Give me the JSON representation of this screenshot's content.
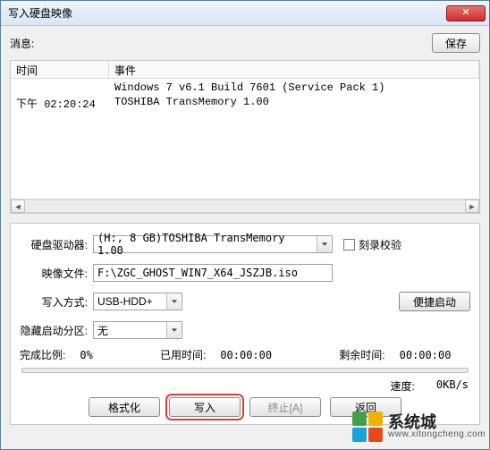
{
  "window": {
    "title": "写入硬盘映像",
    "close_glyph": "✕"
  },
  "top": {
    "message_label": "消息:",
    "save_label": "保存"
  },
  "log": {
    "col_time": "时间",
    "col_event": "事件",
    "rows": [
      {
        "time": "",
        "event": "Windows 7 v6.1 Build 7601 (Service Pack 1)"
      },
      {
        "time": "下午 02:20:24",
        "event": "TOSHIBA TransMemory    1.00"
      }
    ],
    "scroll_left": "◄",
    "scroll_right": "►"
  },
  "form": {
    "drive_label": "硬盘驱动器:",
    "drive_value": "(H:, 8 GB)TOSHIBA TransMemory    1.00",
    "verify_label": "刻录校验",
    "image_label": "映像文件:",
    "image_value": "F:\\ZGC_GHOST_WIN7_X64_JSZJB.iso",
    "mode_label": "写入方式:",
    "mode_value": "USB-HDD+",
    "quickboot_label": "便捷启动",
    "hidden_label": "隐藏启动分区:",
    "hidden_value": "无"
  },
  "progress": {
    "percent_label": "完成比例:",
    "percent_value": "0%",
    "elapsed_label": "已用时间:",
    "elapsed_value": "00:00:00",
    "remaining_label": "剩余时间:",
    "remaining_value": "00:00:00",
    "speed_label": "速度:",
    "speed_value": "0KB/s"
  },
  "buttons": {
    "format": "格式化",
    "write": "写入",
    "abort": "终止[A]",
    "back": "返回"
  },
  "watermark": {
    "title": "系统城",
    "url": "www.xitongcheng.com"
  }
}
